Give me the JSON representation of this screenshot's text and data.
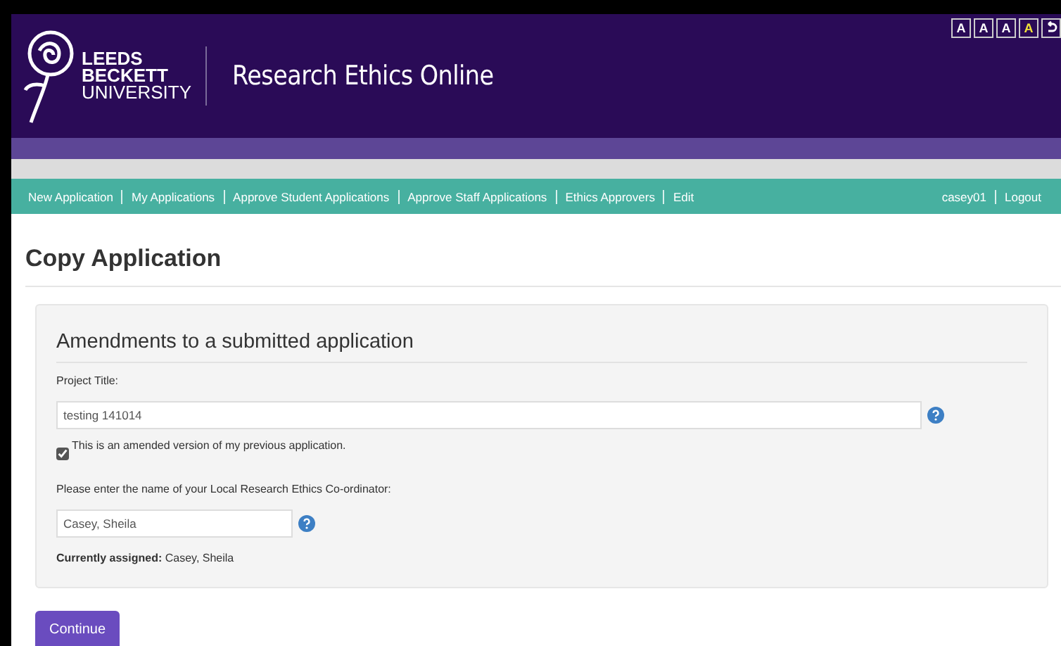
{
  "header": {
    "logo_lines": [
      "LEEDS",
      "BECKETT",
      "UNIVERSITY"
    ],
    "title": "Research Ethics Online",
    "text_size_buttons": [
      {
        "label": "A",
        "selected": false
      },
      {
        "label": "A",
        "selected": false
      },
      {
        "label": "A",
        "selected": false
      },
      {
        "label": "A",
        "selected": true
      }
    ]
  },
  "nav": {
    "items": [
      {
        "label": "New Application"
      },
      {
        "label": "My Applications"
      },
      {
        "label": "Approve Student Applications"
      },
      {
        "label": "Approve Staff Applications"
      },
      {
        "label": "Ethics Approvers"
      },
      {
        "label": "Edit"
      }
    ],
    "user_items": [
      {
        "label": "casey01"
      },
      {
        "label": "Logout"
      }
    ]
  },
  "page_title": "Copy Application",
  "panel": {
    "heading": "Amendments to a submitted application",
    "project_title": {
      "label": "Project Title:",
      "value": "testing 141014"
    },
    "amended": {
      "label": "This is an amended version of my previous application.",
      "checked": true
    },
    "coordinator": {
      "label": "Please enter the name of your Local Research Ethics Co-ordinator:",
      "value": "Casey, Sheila"
    },
    "assigned": "**Currently assigned:** Casey, Sheila"
  },
  "continue_button": "Continue"
}
